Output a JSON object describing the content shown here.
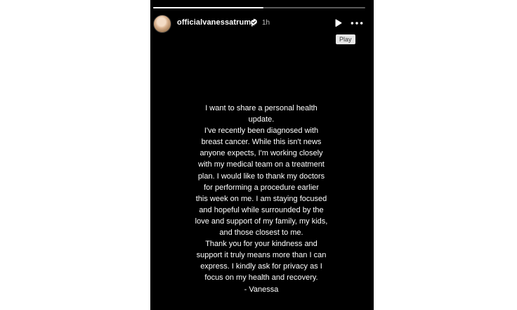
{
  "story": {
    "progress": 0.52,
    "username": "officialvanessatrump",
    "time": "1h",
    "tooltip": "Play",
    "message_lines": [
      "I want to share a personal health",
      "update.",
      "I've recently been diagnosed with",
      "breast cancer. While this isn't news",
      "anyone expects, I'm working closely",
      "with my medical team on a treatment",
      "plan. I would like to thank my doctors",
      "for performing a procedure earlier",
      "this week on me. I am staying focused",
      "and hopeful while surrounded by the",
      "love and support of my family, my kids,",
      "and those closest to me.",
      "Thank you for your kindness and",
      "support it truly means more than I can",
      "express. I kindly ask for privacy as I",
      "focus on my health and recovery.",
      "- Vanessa"
    ]
  },
  "icons": {
    "verified": "verified-badge-icon",
    "play": "play-icon",
    "more": "more-options-icon"
  },
  "colors": {
    "story_background": "#000000",
    "page_background": "#ffffff",
    "verified_badge": "#ffffff",
    "tooltip_background": "#e6e6e6"
  }
}
